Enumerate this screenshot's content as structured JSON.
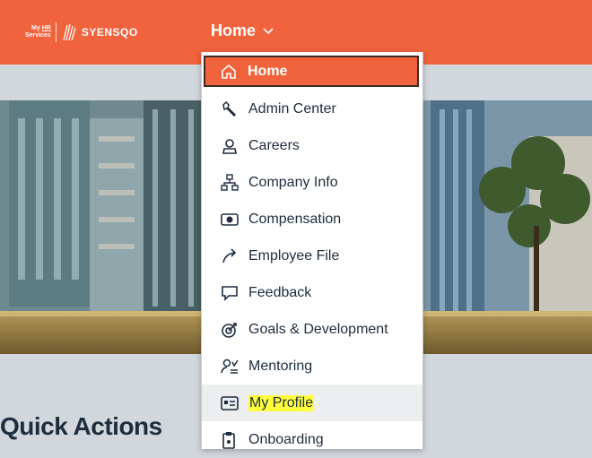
{
  "header": {
    "logo_my": "My",
    "logo_hr": "HR",
    "logo_services": "Services",
    "brand": "SYENSQO",
    "nav_label": "Home",
    "accent_color": "#f0633c"
  },
  "menu": {
    "items": [
      {
        "label": "Home",
        "icon": "home-icon"
      },
      {
        "label": "Admin Center",
        "icon": "wrench-icon"
      },
      {
        "label": "Careers",
        "icon": "person-icon"
      },
      {
        "label": "Company Info",
        "icon": "org-chart-icon"
      },
      {
        "label": "Compensation",
        "icon": "money-icon"
      },
      {
        "label": "Employee File",
        "icon": "arrow-forward-icon"
      },
      {
        "label": "Feedback",
        "icon": "feedback-icon"
      },
      {
        "label": "Goals & Development",
        "icon": "target-icon"
      },
      {
        "label": "Mentoring",
        "icon": "mentoring-icon"
      },
      {
        "label": "My Profile",
        "icon": "id-card-icon"
      },
      {
        "label": "Onboarding",
        "icon": "onboarding-icon"
      }
    ],
    "selected": "Home",
    "highlighted": "My Profile"
  },
  "main": {
    "section_title": "Quick Actions"
  }
}
